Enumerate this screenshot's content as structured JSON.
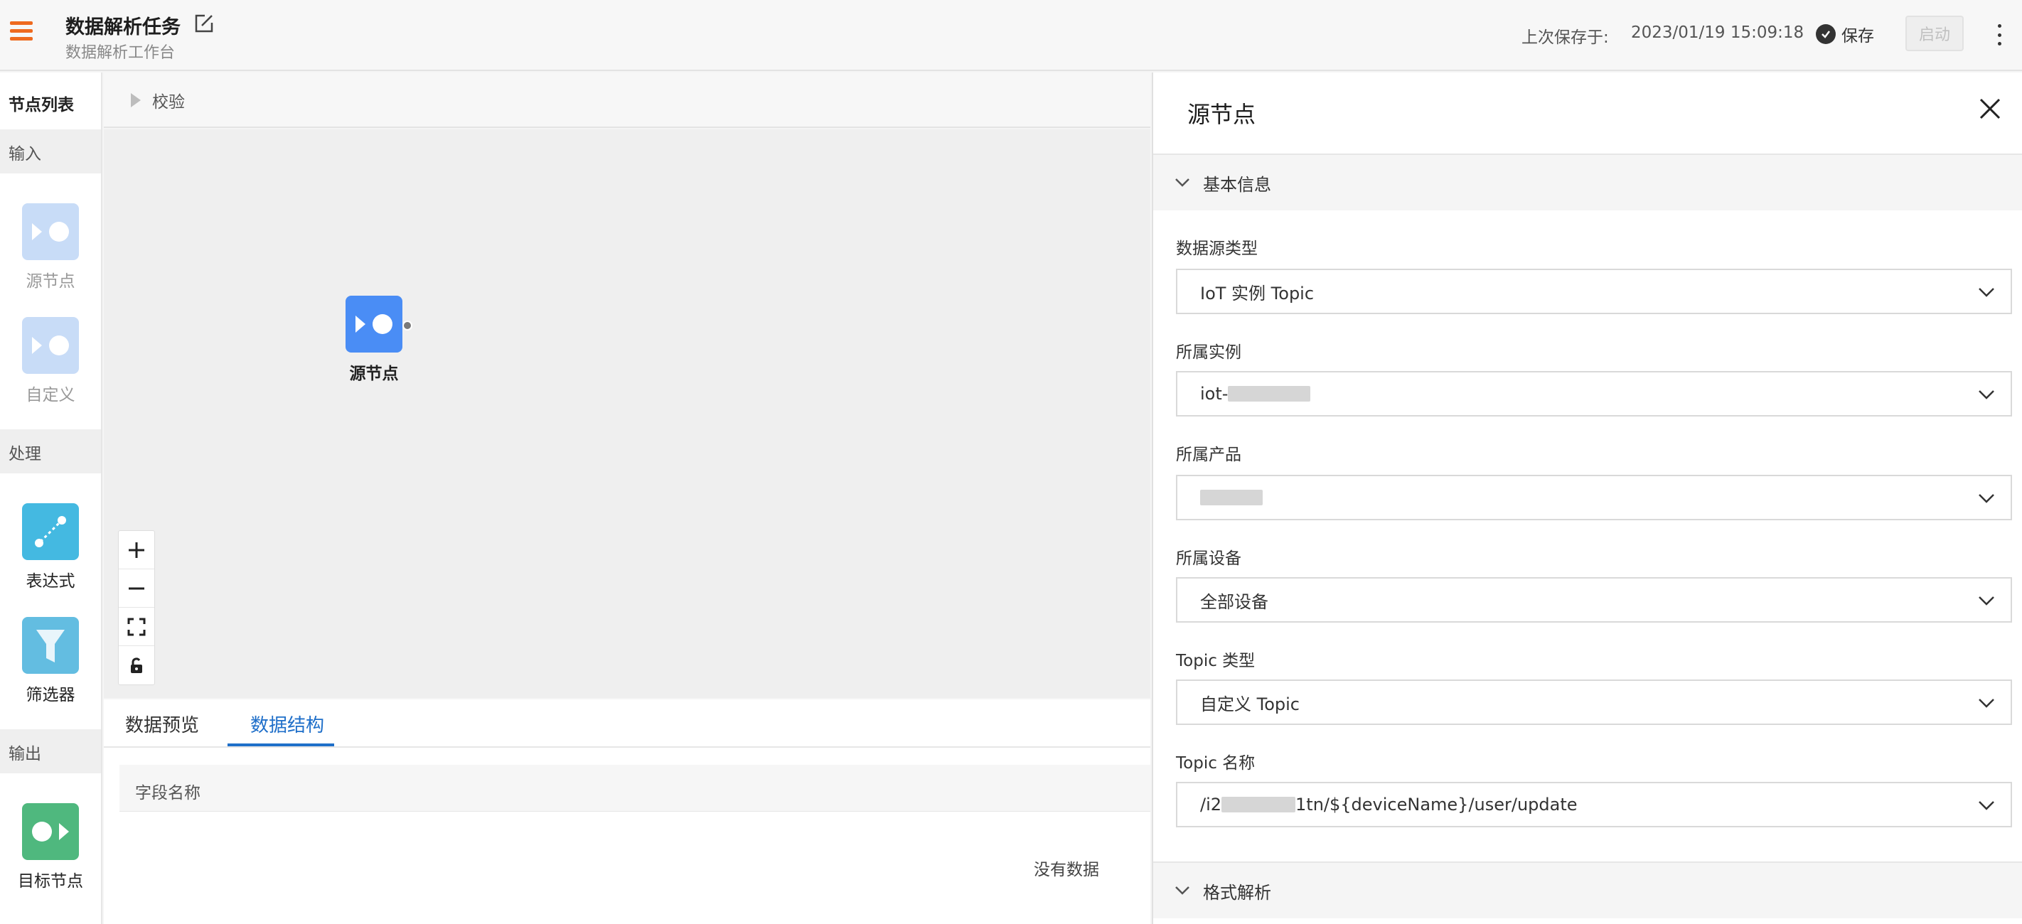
{
  "header": {
    "title": "数据解析任务",
    "subtitle": "数据解析工作台",
    "last_saved_label": "上次保存于:",
    "last_saved_time": "2023/01/19 15:09:18",
    "save_label": "保存",
    "start_label": "启动"
  },
  "sidebar": {
    "title": "节点列表",
    "sections": {
      "input": "输入",
      "process": "处理",
      "output": "输出"
    },
    "nodes": {
      "source": "源节点",
      "custom": "自定义",
      "expression": "表达式",
      "filter": "筛选器",
      "target": "目标节点"
    }
  },
  "toolbar": {
    "validate_label": "校验"
  },
  "canvas": {
    "node_label": "源节点"
  },
  "bottom": {
    "tabs": [
      "数据预览",
      "数据结构"
    ],
    "active_tab": "数据结构",
    "column_header": "字段名称",
    "empty_text": "没有数据"
  },
  "panel": {
    "title": "源节点",
    "sections": {
      "basic": "基本信息",
      "format": "格式解析"
    },
    "fields": {
      "source_type": {
        "label": "数据源类型",
        "value": "IoT 实例 Topic"
      },
      "instance": {
        "label": "所属实例",
        "value_prefix": "iot-"
      },
      "product": {
        "label": "所属产品"
      },
      "device": {
        "label": "所属设备",
        "value": "全部设备"
      },
      "topic_type": {
        "label": "Topic 类型",
        "value": "自定义 Topic"
      },
      "topic_name": {
        "label": "Topic 名称",
        "value_prefix": "/i2",
        "value_suffix": "1tn/${deviceName}/user/update"
      }
    }
  },
  "colors": {
    "accent_orange": "#ee6a1f",
    "tab_blue": "#1f6fc9",
    "source_node_blue": "#4a8df5",
    "expression_cyan": "#44b9e1",
    "filter_cyan": "#63bde1",
    "target_green": "#4fb87e"
  }
}
